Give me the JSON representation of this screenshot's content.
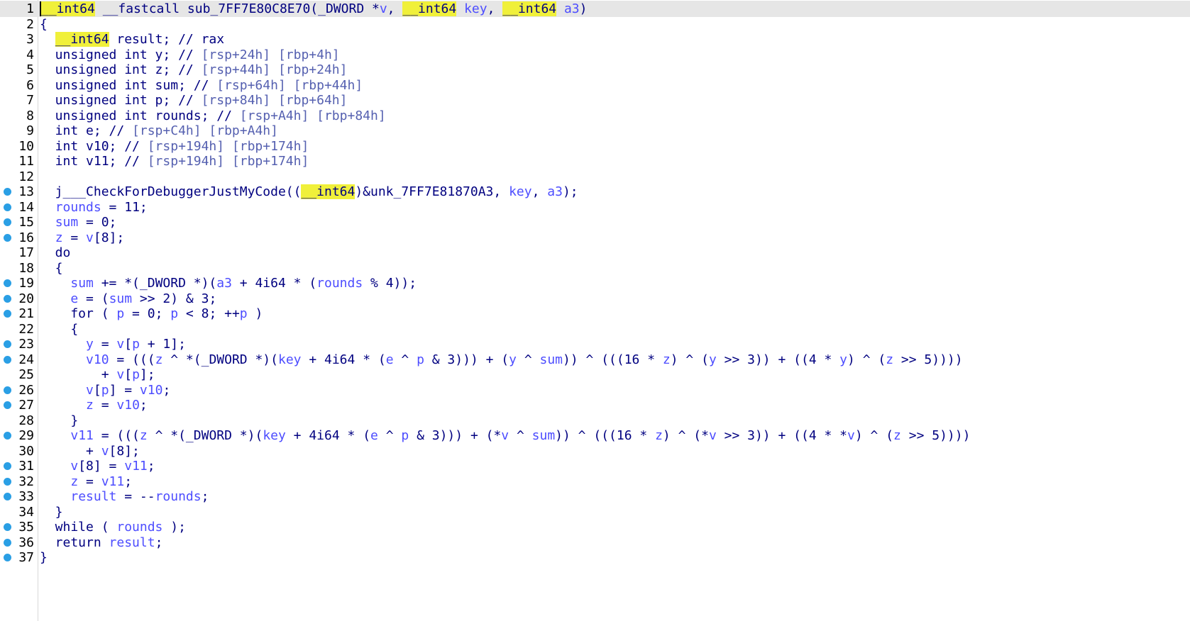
{
  "colors": {
    "background": "#ffffff",
    "keyword_text": "#000080",
    "variable_text": "#4d4dff",
    "comment_text": "#5560b0",
    "highlight": "#f0f03a",
    "breakpoint_marker": "#2a9fe5",
    "current_line": "#e6e6e6"
  },
  "icons": {
    "line_marker": "breakpoint-dot-icon"
  },
  "lines": [
    {
      "n": "1",
      "bp": false,
      "cur": true,
      "tokens": [
        [
          "__int64",
          "hl"
        ],
        [
          " __fastcall sub_7FF7E80C8E70(_DWORD *",
          ""
        ],
        [
          "v",
          "v"
        ],
        [
          ", ",
          ""
        ],
        [
          "__int64",
          "hl"
        ],
        [
          " ",
          ""
        ],
        [
          "key",
          "v"
        ],
        [
          ", ",
          ""
        ],
        [
          "__int64",
          "hl"
        ],
        [
          " ",
          ""
        ],
        [
          "a3",
          "v"
        ],
        [
          ")",
          ""
        ]
      ]
    },
    {
      "n": "2",
      "bp": false,
      "tokens": [
        [
          "{",
          ""
        ]
      ]
    },
    {
      "n": "3",
      "bp": false,
      "tokens": [
        [
          "  ",
          ""
        ],
        [
          "__int64",
          "hl"
        ],
        [
          " result; // rax",
          ""
        ]
      ]
    },
    {
      "n": "4",
      "bp": false,
      "tokens": [
        [
          "  unsigned int y; // ",
          ""
        ],
        [
          "[rsp+24h] [rbp+4h]",
          "cm"
        ]
      ]
    },
    {
      "n": "5",
      "bp": false,
      "tokens": [
        [
          "  unsigned int z; // ",
          ""
        ],
        [
          "[rsp+44h] [rbp+24h]",
          "cm"
        ]
      ]
    },
    {
      "n": "6",
      "bp": false,
      "tokens": [
        [
          "  unsigned int sum; // ",
          ""
        ],
        [
          "[rsp+64h] [rbp+44h]",
          "cm"
        ]
      ]
    },
    {
      "n": "7",
      "bp": false,
      "tokens": [
        [
          "  unsigned int p; // ",
          ""
        ],
        [
          "[rsp+84h] [rbp+64h]",
          "cm"
        ]
      ]
    },
    {
      "n": "8",
      "bp": false,
      "tokens": [
        [
          "  unsigned int rounds; // ",
          ""
        ],
        [
          "[rsp+A4h] [rbp+84h]",
          "cm"
        ]
      ]
    },
    {
      "n": "9",
      "bp": false,
      "tokens": [
        [
          "  int e; // ",
          ""
        ],
        [
          "[rsp+C4h] [rbp+A4h]",
          "cm"
        ]
      ]
    },
    {
      "n": "10",
      "bp": false,
      "tokens": [
        [
          "  int v10; // ",
          ""
        ],
        [
          "[rsp+194h] [rbp+174h]",
          "cm"
        ]
      ]
    },
    {
      "n": "11",
      "bp": false,
      "tokens": [
        [
          "  int v11; // ",
          ""
        ],
        [
          "[rsp+194h] [rbp+174h]",
          "cm"
        ]
      ]
    },
    {
      "n": "12",
      "bp": false,
      "tokens": []
    },
    {
      "n": "13",
      "bp": true,
      "tokens": [
        [
          "  j___CheckForDebuggerJustMyCode((",
          ""
        ],
        [
          "__int64",
          "hl"
        ],
        [
          ")&unk_7FF7E81870A3, ",
          ""
        ],
        [
          "key",
          "v"
        ],
        [
          ", ",
          ""
        ],
        [
          "a3",
          "v"
        ],
        [
          ");",
          ""
        ]
      ]
    },
    {
      "n": "14",
      "bp": true,
      "tokens": [
        [
          "  ",
          ""
        ],
        [
          "rounds",
          "v"
        ],
        [
          " = 11;",
          ""
        ]
      ]
    },
    {
      "n": "15",
      "bp": true,
      "tokens": [
        [
          "  ",
          ""
        ],
        [
          "sum",
          "v"
        ],
        [
          " = 0;",
          ""
        ]
      ]
    },
    {
      "n": "16",
      "bp": true,
      "tokens": [
        [
          "  ",
          ""
        ],
        [
          "z",
          "v"
        ],
        [
          " = ",
          ""
        ],
        [
          "v",
          "v"
        ],
        [
          "[8];",
          ""
        ]
      ]
    },
    {
      "n": "17",
      "bp": false,
      "tokens": [
        [
          "  do",
          ""
        ]
      ]
    },
    {
      "n": "18",
      "bp": false,
      "tokens": [
        [
          "  {",
          ""
        ]
      ]
    },
    {
      "n": "19",
      "bp": true,
      "tokens": [
        [
          "    ",
          ""
        ],
        [
          "sum",
          "v"
        ],
        [
          " += *(_DWORD *)(",
          ""
        ],
        [
          "a3",
          "v"
        ],
        [
          " + 4i64 * (",
          ""
        ],
        [
          "rounds",
          "v"
        ],
        [
          " % 4));",
          ""
        ]
      ]
    },
    {
      "n": "20",
      "bp": true,
      "tokens": [
        [
          "    ",
          ""
        ],
        [
          "e",
          "v"
        ],
        [
          " = (",
          ""
        ],
        [
          "sum",
          "v"
        ],
        [
          " >> 2) & 3;",
          ""
        ]
      ]
    },
    {
      "n": "21",
      "bp": true,
      "tokens": [
        [
          "    for ( ",
          ""
        ],
        [
          "p",
          "v"
        ],
        [
          " = 0; ",
          ""
        ],
        [
          "p",
          "v"
        ],
        [
          " < 8; ++",
          ""
        ],
        [
          "p",
          "v"
        ],
        [
          " )",
          ""
        ]
      ]
    },
    {
      "n": "22",
      "bp": false,
      "tokens": [
        [
          "    {",
          ""
        ]
      ]
    },
    {
      "n": "23",
      "bp": true,
      "tokens": [
        [
          "      ",
          ""
        ],
        [
          "y",
          "v"
        ],
        [
          " = ",
          ""
        ],
        [
          "v",
          "v"
        ],
        [
          "[",
          ""
        ],
        [
          "p",
          "v"
        ],
        [
          " + 1];",
          ""
        ]
      ]
    },
    {
      "n": "24",
      "bp": true,
      "tokens": [
        [
          "      ",
          ""
        ],
        [
          "v10",
          "v"
        ],
        [
          " = (((",
          ""
        ],
        [
          "z",
          "v"
        ],
        [
          " ^ *(_DWORD *)(",
          ""
        ],
        [
          "key",
          "v"
        ],
        [
          " + 4i64 * (",
          ""
        ],
        [
          "e",
          "v"
        ],
        [
          " ^ ",
          ""
        ],
        [
          "p",
          "v"
        ],
        [
          " & 3))) + (",
          ""
        ],
        [
          "y",
          "v"
        ],
        [
          " ^ ",
          ""
        ],
        [
          "sum",
          "v"
        ],
        [
          ")) ^ (((16 * ",
          ""
        ],
        [
          "z",
          "v"
        ],
        [
          ") ^ (",
          ""
        ],
        [
          "y",
          "v"
        ],
        [
          " >> 3)) + ((4 * ",
          ""
        ],
        [
          "y",
          "v"
        ],
        [
          ") ^ (",
          ""
        ],
        [
          "z",
          "v"
        ],
        [
          " >> 5))))",
          ""
        ]
      ]
    },
    {
      "n": "25",
      "bp": false,
      "tokens": [
        [
          "        + ",
          ""
        ],
        [
          "v",
          "v"
        ],
        [
          "[",
          ""
        ],
        [
          "p",
          "v"
        ],
        [
          "];",
          ""
        ]
      ]
    },
    {
      "n": "26",
      "bp": true,
      "tokens": [
        [
          "      ",
          ""
        ],
        [
          "v",
          "v"
        ],
        [
          "[",
          ""
        ],
        [
          "p",
          "v"
        ],
        [
          "] = ",
          ""
        ],
        [
          "v10",
          "v"
        ],
        [
          ";",
          ""
        ]
      ]
    },
    {
      "n": "27",
      "bp": true,
      "tokens": [
        [
          "      ",
          ""
        ],
        [
          "z",
          "v"
        ],
        [
          " = ",
          ""
        ],
        [
          "v10",
          "v"
        ],
        [
          ";",
          ""
        ]
      ]
    },
    {
      "n": "28",
      "bp": false,
      "tokens": [
        [
          "    }",
          ""
        ]
      ]
    },
    {
      "n": "29",
      "bp": true,
      "tokens": [
        [
          "    ",
          ""
        ],
        [
          "v11",
          "v"
        ],
        [
          " = (((",
          ""
        ],
        [
          "z",
          "v"
        ],
        [
          " ^ *(_DWORD *)(",
          ""
        ],
        [
          "key",
          "v"
        ],
        [
          " + 4i64 * (",
          ""
        ],
        [
          "e",
          "v"
        ],
        [
          " ^ ",
          ""
        ],
        [
          "p",
          "v"
        ],
        [
          " & 3))) + (*",
          ""
        ],
        [
          "v",
          "v"
        ],
        [
          " ^ ",
          ""
        ],
        [
          "sum",
          "v"
        ],
        [
          ")) ^ (((16 * ",
          ""
        ],
        [
          "z",
          "v"
        ],
        [
          ") ^ (*",
          ""
        ],
        [
          "v",
          "v"
        ],
        [
          " >> 3)) + ((4 * *",
          ""
        ],
        [
          "v",
          "v"
        ],
        [
          ") ^ (",
          ""
        ],
        [
          "z",
          "v"
        ],
        [
          " >> 5))))",
          ""
        ]
      ]
    },
    {
      "n": "30",
      "bp": false,
      "tokens": [
        [
          "      + ",
          ""
        ],
        [
          "v",
          "v"
        ],
        [
          "[8];",
          ""
        ]
      ]
    },
    {
      "n": "31",
      "bp": true,
      "tokens": [
        [
          "    ",
          ""
        ],
        [
          "v",
          "v"
        ],
        [
          "[8] = ",
          ""
        ],
        [
          "v11",
          "v"
        ],
        [
          ";",
          ""
        ]
      ]
    },
    {
      "n": "32",
      "bp": true,
      "tokens": [
        [
          "    ",
          ""
        ],
        [
          "z",
          "v"
        ],
        [
          " = ",
          ""
        ],
        [
          "v11",
          "v"
        ],
        [
          ";",
          ""
        ]
      ]
    },
    {
      "n": "33",
      "bp": true,
      "tokens": [
        [
          "    ",
          ""
        ],
        [
          "result",
          "v"
        ],
        [
          " = --",
          ""
        ],
        [
          "rounds",
          "v"
        ],
        [
          ";",
          ""
        ]
      ]
    },
    {
      "n": "34",
      "bp": false,
      "tokens": [
        [
          "  }",
          ""
        ]
      ]
    },
    {
      "n": "35",
      "bp": true,
      "tokens": [
        [
          "  while ( ",
          ""
        ],
        [
          "rounds",
          "v"
        ],
        [
          " );",
          ""
        ]
      ]
    },
    {
      "n": "36",
      "bp": true,
      "tokens": [
        [
          "  return ",
          ""
        ],
        [
          "result",
          "v"
        ],
        [
          ";",
          ""
        ]
      ]
    },
    {
      "n": "37",
      "bp": true,
      "tokens": [
        [
          "}",
          ""
        ]
      ]
    }
  ]
}
